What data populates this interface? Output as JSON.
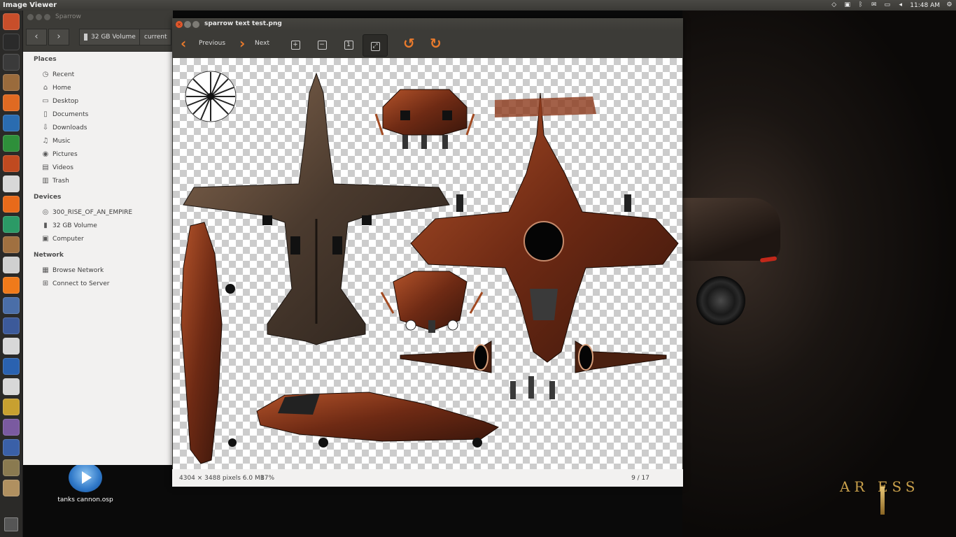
{
  "top_panel": {
    "app_title": "Image Viewer",
    "clock": "11:48 AM",
    "tray_icons": [
      "wifi-icon",
      "bluetooth-icon",
      "keyboard-icon",
      "mail-icon",
      "battery-icon",
      "volume-icon",
      "settings-gear-icon"
    ]
  },
  "launcher": {
    "items": [
      "ubuntu-dash-icon",
      "terminal-icon",
      "app-icon",
      "files-icon",
      "firefox-icon",
      "writer-icon",
      "calc-icon",
      "impress-icon",
      "software-center-icon",
      "app-store-icon",
      "headphones-icon",
      "glass-icon",
      "disc-icon",
      "vlc-icon",
      "app-icon",
      "gimp-icon",
      "gmail-icon",
      "player-icon",
      "webcam-icon",
      "app-icon",
      "video-icon",
      "blender-icon",
      "app-icon",
      "image-viewer-icon"
    ]
  },
  "file_manager": {
    "title": "Sparrow",
    "path": [
      "32 GB Volume",
      "current"
    ],
    "sections": [
      {
        "header": "Places",
        "items": [
          {
            "label": "Recent",
            "icon": "clock-icon"
          },
          {
            "label": "Home",
            "icon": "home-icon"
          },
          {
            "label": "Desktop",
            "icon": "folder-icon"
          },
          {
            "label": "Documents",
            "icon": "document-icon"
          },
          {
            "label": "Downloads",
            "icon": "download-icon"
          },
          {
            "label": "Music",
            "icon": "music-icon"
          },
          {
            "label": "Pictures",
            "icon": "camera-icon"
          },
          {
            "label": "Videos",
            "icon": "film-icon"
          },
          {
            "label": "Trash",
            "icon": "trash-icon"
          }
        ]
      },
      {
        "header": "Devices",
        "items": [
          {
            "label": "300_RISE_OF_AN_EMPIRE",
            "icon": "disc-icon"
          },
          {
            "label": "32 GB Volume",
            "icon": "drive-icon"
          },
          {
            "label": "Computer",
            "icon": "computer-icon"
          }
        ]
      },
      {
        "header": "Network",
        "items": [
          {
            "label": "Browse Network",
            "icon": "network-icon"
          },
          {
            "label": "Connect to Server",
            "icon": "server-icon"
          }
        ]
      }
    ]
  },
  "image_viewer": {
    "title": "sparrow text test.png",
    "toolbar": {
      "previous_label": "Previous",
      "next_label": "Next"
    },
    "status": {
      "dimensions": "4304 × 3488 pixels  6.0 MB",
      "zoom": "17%",
      "position": "9 / 17"
    },
    "accent_color": "#e97a2c"
  },
  "desktop": {
    "file_icon_label": "tanks cannon.osp",
    "logo_text": "AR  ESS"
  }
}
